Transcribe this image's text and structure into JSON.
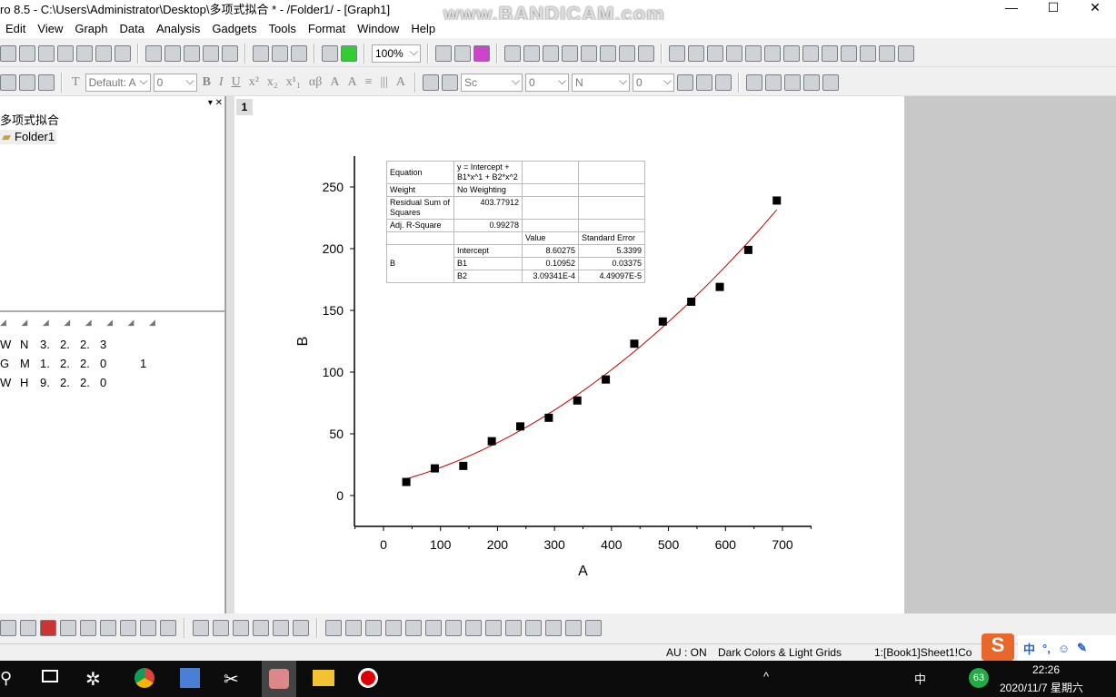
{
  "window": {
    "title": "ro 8.5 - C:\\Users\\Administrator\\Desktop\\多项式拟合 * - /Folder1/ - [Graph1]",
    "watermark": "www.BANDICAM.com",
    "controls": [
      "—",
      "☐",
      "✕"
    ]
  },
  "menu": [
    "Edit",
    "View",
    "Graph",
    "Data",
    "Analysis",
    "Gadgets",
    "Tools",
    "Format",
    "Window",
    "Help"
  ],
  "toolbar": {
    "zoom": "100%",
    "font": "Default: A",
    "font_size": "0",
    "line_style": "Sc",
    "line_width": "0",
    "fill_label": "N",
    "fill_value": "0"
  },
  "project": {
    "root": "多项式拟合",
    "folder": "Folder1"
  },
  "worksheet_rows": [
    [
      "W",
      "N",
      "3.",
      "2.",
      "2.",
      "3",
      "",
      ""
    ],
    [
      "G",
      "M",
      "1.",
      "2.",
      "2.",
      "0",
      "",
      "1"
    ],
    [
      "W",
      "H",
      "9.",
      "2.",
      "2.",
      "0",
      "",
      ""
    ]
  ],
  "graph": {
    "page_number": "1"
  },
  "fit_table": {
    "equation_label": "Equation",
    "equation": "y = Intercept + B1*x^1 + B2*x^2",
    "weight_label": "Weight",
    "weight": "No Weighting",
    "rss_label": "Residual Sum of Squares",
    "rss": "403.77912",
    "adjr_label": "Adj. R-Square",
    "adjr": "0.99278",
    "value_header": "Value",
    "se_header": "Standard Error",
    "group": "B",
    "params": [
      {
        "name": "Intercept",
        "value": "8.60275",
        "se": "5.3399"
      },
      {
        "name": "B1",
        "value": "0.10952",
        "se": "0.03375"
      },
      {
        "name": "B2",
        "value": "3.09341E-4",
        "se": "4.49097E-5"
      }
    ]
  },
  "chart_data": {
    "type": "scatter",
    "xlabel": "A",
    "ylabel": "B",
    "xlim": [
      -51,
      751
    ],
    "ylim": [
      -25,
      275
    ],
    "xticks": [
      0,
      100,
      200,
      300,
      400,
      500,
      600,
      700
    ],
    "yticks": [
      0,
      50,
      100,
      150,
      200,
      250
    ],
    "grid": false,
    "x": [
      40,
      90,
      140,
      190,
      240,
      290,
      340,
      390,
      440,
      490,
      540,
      590,
      640,
      690
    ],
    "y": [
      11,
      22,
      24,
      44,
      56,
      63,
      77,
      94,
      123,
      141,
      157,
      169,
      199,
      239
    ],
    "fit": {
      "type": "polynomial",
      "intercept": 8.60275,
      "b1": 0.10952,
      "b2": 0.000309341,
      "color": "#c00000"
    },
    "marker_color": "#000000"
  },
  "status": {
    "au": "AU : ON",
    "theme": "Dark Colors & Light Grids",
    "cell": "1:[Book1]Sheet1!Co"
  },
  "ime": {
    "lang": "中",
    "punct": "°,"
  },
  "taskbar": {
    "time": "22:26",
    "date": "2020/11/7 星期六",
    "tray_lang": "中",
    "badge": "63"
  }
}
